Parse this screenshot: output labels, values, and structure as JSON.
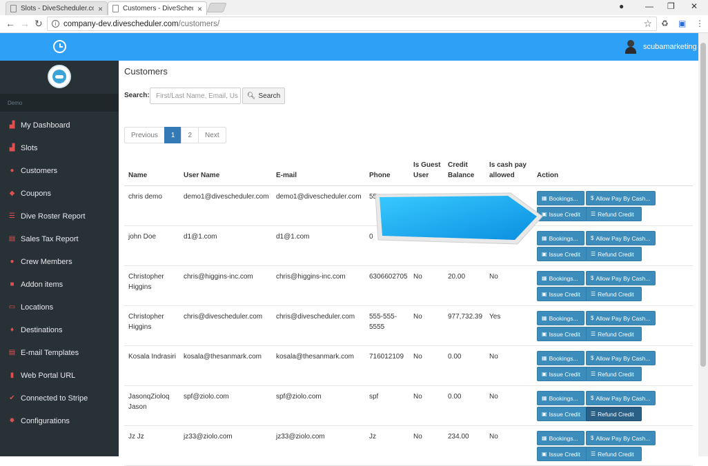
{
  "browser": {
    "tabs": [
      {
        "title": "Slots - DiveScheduler.co"
      },
      {
        "title": "Customers - DiveSchedu"
      }
    ],
    "url_host": "company-dev.divescheduler.com",
    "url_path": "/customers/"
  },
  "header": {
    "user_name": "scubamarketing"
  },
  "sidebar": {
    "section_label": "Demo",
    "items": [
      {
        "label": "My Dashboard",
        "icon": "sitemap-icon"
      },
      {
        "label": "Slots",
        "icon": "sitemap-icon"
      },
      {
        "label": "Customers",
        "icon": "users-icon"
      },
      {
        "label": "Coupons",
        "icon": "tag-icon"
      },
      {
        "label": "Dive Roster Report",
        "icon": "list-icon"
      },
      {
        "label": "Sales Tax Report",
        "icon": "document-icon"
      },
      {
        "label": "Crew Members",
        "icon": "users-icon"
      },
      {
        "label": "Addon items",
        "icon": "briefcase-icon"
      },
      {
        "label": "Locations",
        "icon": "map-icon"
      },
      {
        "label": "Destinations",
        "icon": "map-marker-icon"
      },
      {
        "label": "E-mail Templates",
        "icon": "document-icon"
      },
      {
        "label": "Web Portal URL",
        "icon": "bookmark-icon"
      },
      {
        "label": "Connected to Stripe",
        "icon": "check-icon"
      },
      {
        "label": "Configurations",
        "icon": "gear-icon"
      }
    ]
  },
  "main": {
    "title": "Customers",
    "search_label": "Search:",
    "search_placeholder": "First/Last Name, Email, Us",
    "search_button": "Search",
    "pagination": [
      "Previous",
      "1",
      "2",
      "Next"
    ],
    "columns": {
      "name": "Name",
      "username": "User Name",
      "email": "E-mail",
      "phone": "Phone",
      "guest_1": "Is Guest",
      "guest_2": "User",
      "credit_1": "Credit",
      "credit_2": "Balance",
      "cash_1": "Is cash pay",
      "cash_2": "allowed",
      "action": "Action"
    },
    "actions": {
      "bookings": "Bookings...",
      "allow_cash": "Allow Pay By Cash...",
      "issue_credit": "Issue Credit",
      "refund_credit": "Refund Credit"
    },
    "rows": [
      {
        "name": "chris demo",
        "name2": "",
        "username": "demo1@divescheduler.com",
        "email": "demo1@divescheduler.com",
        "phone": "55",
        "phone2": "",
        "guest": "",
        "credit": "",
        "cash": ""
      },
      {
        "name": "john Doe",
        "name2": "",
        "username": "d1@1.com",
        "email": "d1@1.com",
        "phone": "0",
        "phone2": "",
        "guest": "",
        "credit": "",
        "cash": ""
      },
      {
        "name": "Christopher",
        "name2": "Higgins",
        "username": "chris@higgins-inc.com",
        "email": "chris@higgins-inc.com",
        "phone": "6306602705",
        "phone2": "",
        "guest": "No",
        "credit": "20.00",
        "cash": "No"
      },
      {
        "name": "Christopher",
        "name2": "Higgins",
        "username": "chris@divescheduler.com",
        "email": "chris@divescheduler.com",
        "phone": "555-555-",
        "phone2": "5555",
        "guest": "No",
        "credit": "977,732.39",
        "cash": "Yes"
      },
      {
        "name": "Kosala Indrasiri",
        "name2": "",
        "username": "kosala@thesanmark.com",
        "email": "kosala@thesanmark.com",
        "phone": "716012109",
        "phone2": "",
        "guest": "No",
        "credit": "0.00",
        "cash": "No"
      },
      {
        "name": "JasonqZioloq",
        "name2": "Jason",
        "username": "spf@ziolo.com",
        "email": "spf@ziolo.com",
        "phone": "spf",
        "phone2": "",
        "guest": "No",
        "credit": "0.00",
        "cash": "No"
      },
      {
        "name": "Jz Jz",
        "name2": "",
        "username": "jz33@ziolo.com",
        "email": "jz33@ziolo.com",
        "phone": "Jz",
        "phone2": "",
        "guest": "No",
        "credit": "234.00",
        "cash": "No"
      }
    ],
    "highlighted_refund_row": 5
  }
}
